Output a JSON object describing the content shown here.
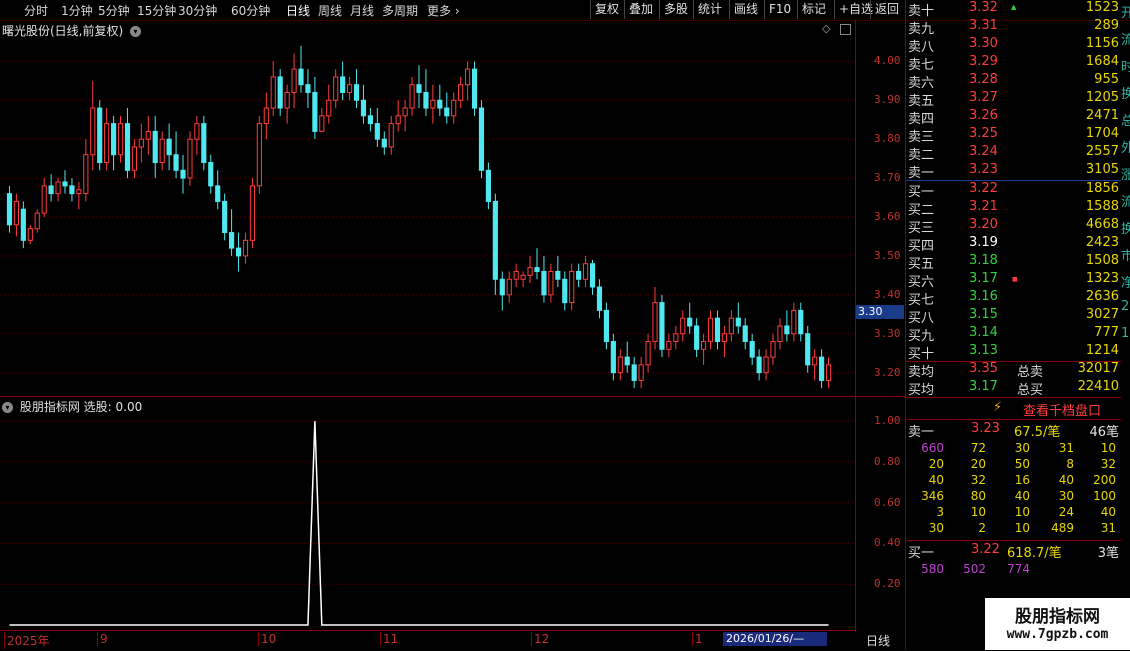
{
  "toolbar": {
    "periods": [
      "分时",
      "1分钟",
      "5分钟",
      "15分钟",
      "30分钟",
      "60分钟",
      "日线",
      "周线",
      "月线",
      "多周期",
      "更多"
    ],
    "active_period": "日线",
    "right_buttons": [
      "复权",
      "叠加",
      "多股",
      "统计",
      "画线",
      "F10",
      "标记",
      "+自选",
      "返回"
    ]
  },
  "main_chart": {
    "title": "曙光股份(日线,前复权)",
    "price_labels": [
      "4.00",
      "3.90",
      "3.80",
      "3.70",
      "3.60",
      "3.50",
      "3.40",
      "3.30",
      "3.20"
    ],
    "current_price_tag": "3.30",
    "y_range": [
      3.14,
      4.06
    ]
  },
  "indicator": {
    "title": "股朋指标网 选股: 0.00",
    "labels": [
      "1.00",
      "0.80",
      "0.60",
      "0.40",
      "0.20"
    ]
  },
  "date_axis": {
    "labels": [
      "2025年",
      "9",
      "10",
      "11",
      "12",
      "1"
    ],
    "cursor_date": "2026/01/26/—",
    "period_tag": "日线"
  },
  "order_book": {
    "sell": [
      {
        "label": "卖十",
        "price": "3.32",
        "vol": "1523",
        "dir": "up"
      },
      {
        "label": "卖九",
        "price": "3.31",
        "vol": "289",
        "dir": "up"
      },
      {
        "label": "卖八",
        "price": "3.30",
        "vol": "1156",
        "dir": "up"
      },
      {
        "label": "卖七",
        "price": "3.29",
        "vol": "1684",
        "dir": "up"
      },
      {
        "label": "卖六",
        "price": "3.28",
        "vol": "955",
        "dir": "up"
      },
      {
        "label": "卖五",
        "price": "3.27",
        "vol": "1205",
        "dir": "up"
      },
      {
        "label": "卖四",
        "price": "3.26",
        "vol": "2471",
        "dir": "up"
      },
      {
        "label": "卖三",
        "price": "3.25",
        "vol": "1704",
        "dir": "up"
      },
      {
        "label": "卖二",
        "price": "3.24",
        "vol": "2557",
        "dir": "up"
      },
      {
        "label": "卖一",
        "price": "3.23",
        "vol": "3105",
        "dir": "up"
      }
    ],
    "buy": [
      {
        "label": "买一",
        "price": "3.22",
        "vol": "1856",
        "dir": "up"
      },
      {
        "label": "买二",
        "price": "3.21",
        "vol": "1588",
        "dir": "up"
      },
      {
        "label": "买三",
        "price": "3.20",
        "vol": "4668",
        "dir": "up"
      },
      {
        "label": "买四",
        "price": "3.19",
        "vol": "2423",
        "dir": "flat"
      },
      {
        "label": "买五",
        "price": "3.18",
        "vol": "1508",
        "dir": "down"
      },
      {
        "label": "买六",
        "price": "3.17",
        "vol": "1323",
        "dir": "down"
      },
      {
        "label": "买七",
        "price": "3.16",
        "vol": "2636",
        "dir": "down"
      },
      {
        "label": "买八",
        "price": "3.15",
        "vol": "3027",
        "dir": "down"
      },
      {
        "label": "买九",
        "price": "3.14",
        "vol": "777",
        "dir": "down"
      },
      {
        "label": "买十",
        "price": "3.13",
        "vol": "1214",
        "dir": "down"
      }
    ],
    "avg_sell": {
      "label": "卖均",
      "price": "3.35",
      "total_label": "总卖",
      "total": "32017"
    },
    "avg_buy": {
      "label": "买均",
      "price": "3.17",
      "total_label": "总买",
      "total": "22410"
    }
  },
  "level2": {
    "button": "查看千档盘口",
    "sell1": {
      "label": "卖一",
      "price": "3.23",
      "per": "67.5/笔",
      "count": "46笔"
    },
    "sell_queue": [
      [
        "660",
        "72",
        "30",
        "31",
        "10"
      ],
      [
        "20",
        "20",
        "50",
        "8",
        "32"
      ],
      [
        "40",
        "32",
        "16",
        "40",
        "200"
      ],
      [
        "346",
        "80",
        "40",
        "30",
        "100"
      ],
      [
        "3",
        "10",
        "10",
        "24",
        "40"
      ],
      [
        "30",
        "2",
        "10",
        "489",
        "31"
      ]
    ],
    "buy1": {
      "label": "买一",
      "price": "3.22",
      "per": "618.7/笔",
      "count": "3笔"
    },
    "buy_queue": [
      "580",
      "502",
      "774"
    ]
  },
  "side_strip": [
    "开",
    "流",
    "时",
    "换",
    "总",
    "外",
    "涨",
    "流",
    "换",
    "市",
    "净",
    "2",
    "1"
  ],
  "watermark": {
    "name": "股朋指标网",
    "url": "www.7gpzb.com"
  },
  "colors": {
    "up": "#ff3c3c",
    "down": "#30d040",
    "cyan": "#4fe8f0",
    "grid": "#8a0000",
    "yellow": "#e8d800"
  },
  "chart_data": {
    "type": "candlestick",
    "y_range": [
      3.14,
      4.06
    ],
    "ohlc": [
      [
        3.66,
        3.68,
        3.56,
        3.58
      ],
      [
        3.58,
        3.66,
        3.55,
        3.64
      ],
      [
        3.62,
        3.64,
        3.52,
        3.54
      ],
      [
        3.54,
        3.58,
        3.53,
        3.57
      ],
      [
        3.57,
        3.62,
        3.56,
        3.61
      ],
      [
        3.61,
        3.7,
        3.6,
        3.68
      ],
      [
        3.68,
        3.71,
        3.64,
        3.66
      ],
      [
        3.66,
        3.7,
        3.64,
        3.69
      ],
      [
        3.69,
        3.72,
        3.66,
        3.68
      ],
      [
        3.68,
        3.7,
        3.64,
        3.66
      ],
      [
        3.66,
        3.69,
        3.62,
        3.67
      ],
      [
        3.66,
        3.8,
        3.64,
        3.76
      ],
      [
        3.76,
        3.95,
        3.72,
        3.88
      ],
      [
        3.88,
        3.9,
        3.72,
        3.74
      ],
      [
        3.74,
        3.88,
        3.72,
        3.84
      ],
      [
        3.84,
        3.86,
        3.72,
        3.76
      ],
      [
        3.76,
        3.86,
        3.74,
        3.84
      ],
      [
        3.84,
        3.88,
        3.7,
        3.72
      ],
      [
        3.72,
        3.8,
        3.7,
        3.78
      ],
      [
        3.78,
        3.84,
        3.74,
        3.8
      ],
      [
        3.8,
        3.86,
        3.76,
        3.82
      ],
      [
        3.82,
        3.86,
        3.7,
        3.74
      ],
      [
        3.74,
        3.82,
        3.72,
        3.8
      ],
      [
        3.8,
        3.84,
        3.72,
        3.76
      ],
      [
        3.76,
        3.82,
        3.7,
        3.72
      ],
      [
        3.72,
        3.76,
        3.66,
        3.7
      ],
      [
        3.7,
        3.82,
        3.68,
        3.8
      ],
      [
        3.8,
        3.86,
        3.76,
        3.84
      ],
      [
        3.84,
        3.86,
        3.72,
        3.74
      ],
      [
        3.74,
        3.76,
        3.66,
        3.68
      ],
      [
        3.68,
        3.72,
        3.62,
        3.64
      ],
      [
        3.64,
        3.66,
        3.54,
        3.56
      ],
      [
        3.56,
        3.62,
        3.5,
        3.52
      ],
      [
        3.52,
        3.56,
        3.46,
        3.5
      ],
      [
        3.5,
        3.56,
        3.48,
        3.54
      ],
      [
        3.54,
        3.7,
        3.52,
        3.68
      ],
      [
        3.68,
        3.86,
        3.66,
        3.84
      ],
      [
        3.84,
        3.92,
        3.8,
        3.88
      ],
      [
        3.88,
        4.0,
        3.86,
        3.96
      ],
      [
        3.96,
        3.98,
        3.86,
        3.88
      ],
      [
        3.88,
        3.94,
        3.84,
        3.92
      ],
      [
        3.92,
        4.02,
        3.88,
        3.98
      ],
      [
        3.98,
        4.04,
        3.92,
        3.94
      ],
      [
        3.94,
        3.98,
        3.88,
        3.92
      ],
      [
        3.92,
        3.96,
        3.8,
        3.82
      ],
      [
        3.82,
        3.88,
        3.82,
        3.86
      ],
      [
        3.86,
        3.94,
        3.84,
        3.9
      ],
      [
        3.9,
        3.98,
        3.88,
        3.96
      ],
      [
        3.96,
        4.0,
        3.9,
        3.92
      ],
      [
        3.92,
        3.96,
        3.9,
        3.94
      ],
      [
        3.94,
        3.98,
        3.88,
        3.9
      ],
      [
        3.9,
        3.94,
        3.84,
        3.86
      ],
      [
        3.86,
        3.88,
        3.82,
        3.84
      ],
      [
        3.84,
        3.88,
        3.78,
        3.8
      ],
      [
        3.8,
        3.82,
        3.76,
        3.78
      ],
      [
        3.78,
        3.86,
        3.76,
        3.84
      ],
      [
        3.84,
        3.9,
        3.82,
        3.86
      ],
      [
        3.86,
        3.9,
        3.82,
        3.88
      ],
      [
        3.88,
        3.96,
        3.86,
        3.94
      ],
      [
        3.94,
        3.99,
        3.88,
        3.92
      ],
      [
        3.92,
        3.98,
        3.86,
        3.88
      ],
      [
        3.88,
        3.94,
        3.84,
        3.9
      ],
      [
        3.9,
        3.94,
        3.86,
        3.88
      ],
      [
        3.88,
        3.92,
        3.84,
        3.86
      ],
      [
        3.86,
        3.92,
        3.84,
        3.9
      ],
      [
        3.9,
        3.96,
        3.88,
        3.94
      ],
      [
        3.94,
        4.0,
        3.9,
        3.98
      ],
      [
        3.98,
        4.0,
        3.86,
        3.88
      ],
      [
        3.88,
        3.9,
        3.7,
        3.72
      ],
      [
        3.72,
        3.74,
        3.62,
        3.64
      ],
      [
        3.64,
        3.66,
        3.4,
        3.44
      ],
      [
        3.44,
        3.46,
        3.36,
        3.4
      ],
      [
        3.4,
        3.46,
        3.38,
        3.44
      ],
      [
        3.44,
        3.48,
        3.42,
        3.46
      ],
      [
        3.44,
        3.46,
        3.42,
        3.45
      ],
      [
        3.45,
        3.5,
        3.43,
        3.47
      ],
      [
        3.47,
        3.52,
        3.44,
        3.46
      ],
      [
        3.46,
        3.5,
        3.38,
        3.4
      ],
      [
        3.4,
        3.48,
        3.38,
        3.46
      ],
      [
        3.46,
        3.5,
        3.42,
        3.44
      ],
      [
        3.44,
        3.46,
        3.36,
        3.38
      ],
      [
        3.38,
        3.48,
        3.36,
        3.46
      ],
      [
        3.46,
        3.48,
        3.42,
        3.44
      ],
      [
        3.44,
        3.5,
        3.42,
        3.48
      ],
      [
        3.48,
        3.49,
        3.4,
        3.42
      ],
      [
        3.42,
        3.44,
        3.34,
        3.36
      ],
      [
        3.36,
        3.38,
        3.26,
        3.28
      ],
      [
        3.28,
        3.3,
        3.18,
        3.2
      ],
      [
        3.2,
        3.26,
        3.18,
        3.24
      ],
      [
        3.24,
        3.28,
        3.2,
        3.22
      ],
      [
        3.22,
        3.24,
        3.16,
        3.18
      ],
      [
        3.18,
        3.24,
        3.16,
        3.22
      ],
      [
        3.22,
        3.3,
        3.2,
        3.28
      ],
      [
        3.28,
        3.42,
        3.26,
        3.38
      ],
      [
        3.38,
        3.4,
        3.24,
        3.26
      ],
      [
        3.26,
        3.3,
        3.24,
        3.28
      ],
      [
        3.28,
        3.32,
        3.26,
        3.3
      ],
      [
        3.3,
        3.36,
        3.28,
        3.34
      ],
      [
        3.34,
        3.38,
        3.3,
        3.32
      ],
      [
        3.32,
        3.34,
        3.24,
        3.26
      ],
      [
        3.26,
        3.3,
        3.22,
        3.28
      ],
      [
        3.28,
        3.36,
        3.26,
        3.34
      ],
      [
        3.34,
        3.36,
        3.26,
        3.28
      ],
      [
        3.28,
        3.32,
        3.24,
        3.3
      ],
      [
        3.3,
        3.36,
        3.28,
        3.34
      ],
      [
        3.34,
        3.38,
        3.3,
        3.32
      ],
      [
        3.32,
        3.34,
        3.26,
        3.28
      ],
      [
        3.28,
        3.3,
        3.22,
        3.24
      ],
      [
        3.24,
        3.26,
        3.18,
        3.2
      ],
      [
        3.2,
        3.26,
        3.18,
        3.24
      ],
      [
        3.24,
        3.3,
        3.22,
        3.28
      ],
      [
        3.28,
        3.34,
        3.26,
        3.32
      ],
      [
        3.32,
        3.36,
        3.28,
        3.3
      ],
      [
        3.3,
        3.38,
        3.28,
        3.36
      ],
      [
        3.36,
        3.38,
        3.28,
        3.3
      ],
      [
        3.3,
        3.32,
        3.2,
        3.22
      ],
      [
        3.22,
        3.26,
        3.18,
        3.24
      ],
      [
        3.24,
        3.26,
        3.16,
        3.18
      ],
      [
        3.18,
        3.24,
        3.16,
        3.22
      ]
    ],
    "indicator_spike_index": 44
  }
}
